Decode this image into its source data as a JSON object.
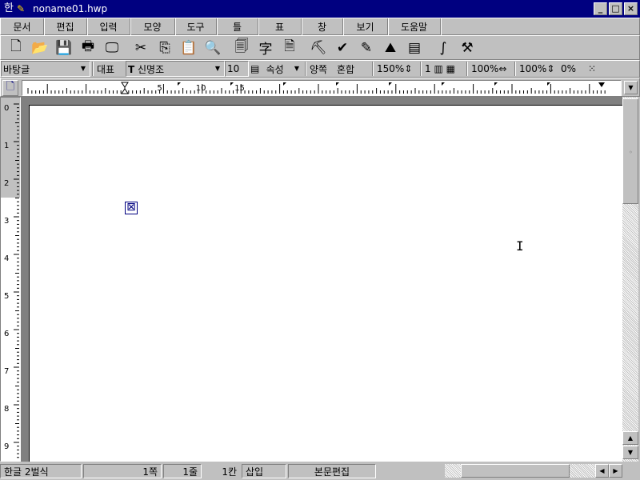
{
  "window": {
    "title": "noname01.hwp",
    "app_icon": "hangul-app-icon",
    "minimize_glyph": "_",
    "restore_glyph": "□",
    "close_glyph": "×"
  },
  "menu": [
    {
      "label": "문서",
      "width": 54
    },
    {
      "label": "편집",
      "width": 54
    },
    {
      "label": "입력",
      "width": 54
    },
    {
      "label": "모양",
      "width": 56
    },
    {
      "label": "도구",
      "width": 52
    },
    {
      "label": "틀",
      "width": 52
    },
    {
      "label": "표",
      "width": 54
    },
    {
      "label": "창",
      "width": 52
    },
    {
      "label": "보기",
      "width": 56
    },
    {
      "label": "도움말",
      "width": 66
    }
  ],
  "toolbar": [
    {
      "name": "new-document-icon",
      "glyph": "🗋"
    },
    {
      "name": "open-folder-icon",
      "glyph": "📂"
    },
    {
      "name": "save-icon",
      "glyph": "💾"
    },
    {
      "name": "print-icon",
      "glyph": "🖶"
    },
    {
      "name": "preview-icon",
      "glyph": "🖵"
    },
    {
      "name": "cut-icon",
      "glyph": "✂"
    },
    {
      "name": "copy-icon",
      "glyph": "⎘"
    },
    {
      "name": "paste-icon",
      "glyph": "📋"
    },
    {
      "name": "find-icon",
      "glyph": "🔍"
    },
    {
      "name": "page-setup-icon",
      "glyph": "🗐"
    },
    {
      "name": "hanja-convert-icon",
      "glyph": "字"
    },
    {
      "name": "document-info-icon",
      "glyph": "🗎"
    },
    {
      "name": "stamp-icon",
      "glyph": "⛏"
    },
    {
      "name": "spell-check-icon",
      "glyph": "✔"
    },
    {
      "name": "draw-icon",
      "glyph": "✎"
    },
    {
      "name": "picture-icon",
      "glyph": "⛰"
    },
    {
      "name": "form-icon",
      "glyph": "▤"
    },
    {
      "name": "equation-icon",
      "glyph": "∫"
    },
    {
      "name": "tools-icon",
      "glyph": "⚒"
    }
  ],
  "format": {
    "style": "바탕글",
    "font_type_label": "대표",
    "font_glyph": "T",
    "font_name": "신명조",
    "font_size": "10",
    "attribute_label": "속성",
    "align_label": "양쪽",
    "mixed_label": "혼합",
    "line_spacing": "150%",
    "columns": "1",
    "width_ratio": "100%",
    "height_ratio": "100%",
    "char_spacing": "0%"
  },
  "ruler": {
    "marks": [
      "5",
      "10",
      "15"
    ],
    "vertical_marks": [
      "0",
      "1",
      "2",
      "3",
      "4",
      "5",
      "6",
      "7",
      "8",
      "9"
    ]
  },
  "status": {
    "input_mode": "한글 2벌식",
    "page": "1쪽",
    "line": "1줄",
    "column": "1칸",
    "insert_mode": "삽입",
    "edit_mode": "본문편집"
  },
  "glyphs": {
    "dropdown": "▼",
    "scroll_up": "▲",
    "scroll_down": "▼",
    "scroll_left": "◀",
    "scroll_right": "▶",
    "control_mark": "⊠",
    "ibeam": "I"
  }
}
